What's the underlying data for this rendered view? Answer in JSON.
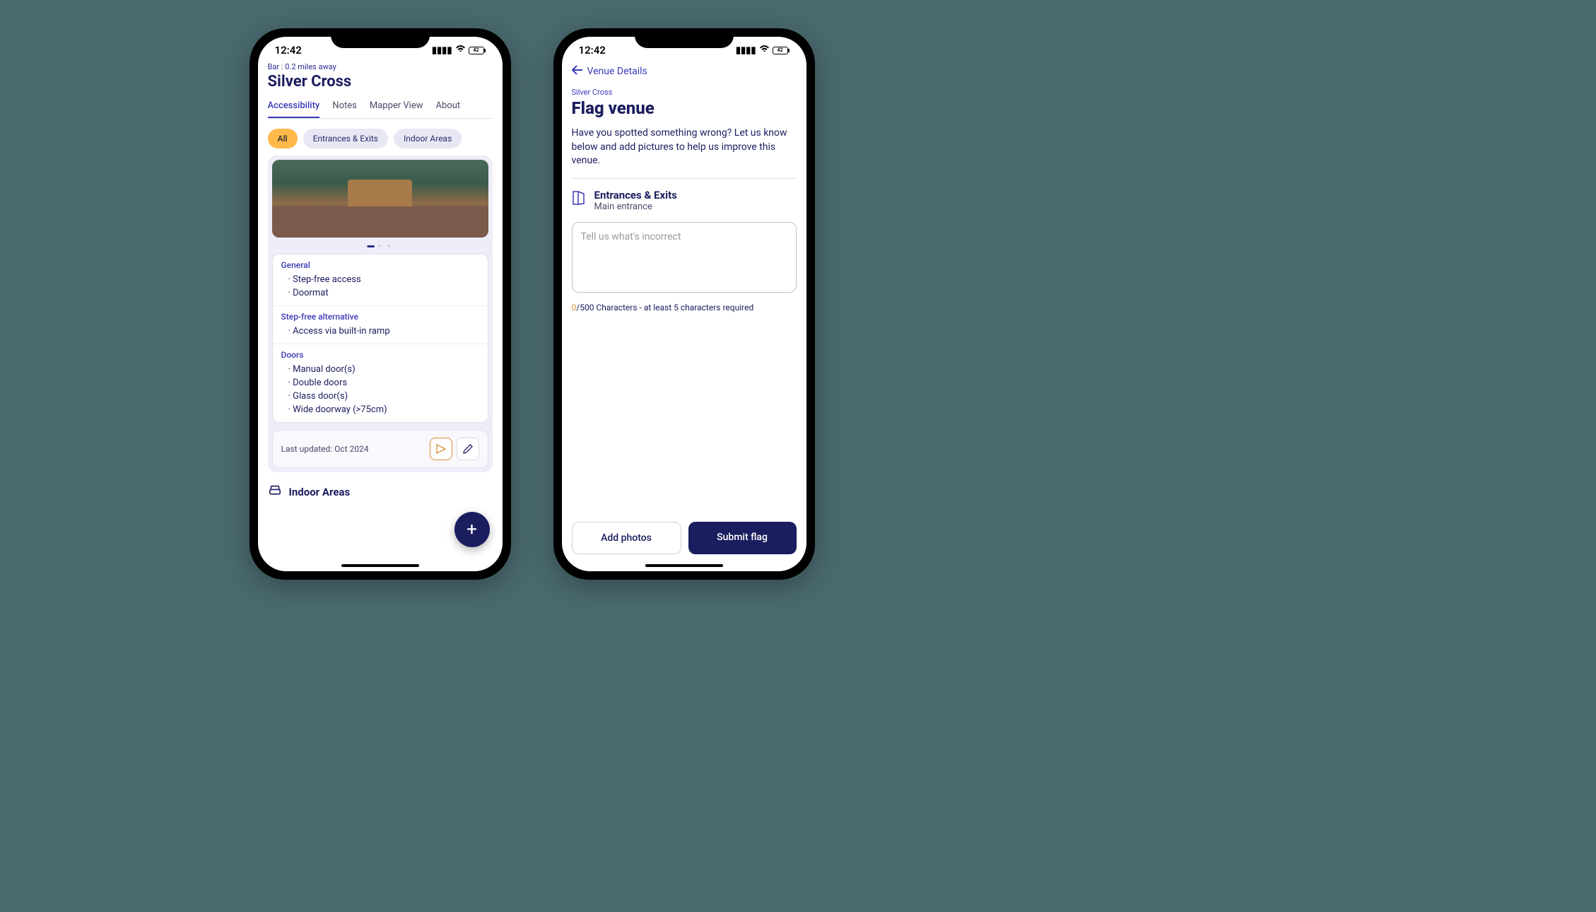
{
  "status": {
    "time": "12:42",
    "battery": "42"
  },
  "screen1": {
    "meta": {
      "category": "Bar",
      "distance": "0.2 miles away"
    },
    "title": "Silver Cross",
    "tabs": [
      "Accessibility",
      "Notes",
      "Mapper View",
      "About"
    ],
    "chips": [
      "All",
      "Entrances & Exits",
      "Indoor Areas"
    ],
    "sections": [
      {
        "heading": "General",
        "items": [
          "Step-free access",
          "Doormat"
        ]
      },
      {
        "heading": "Step-free alternative",
        "items": [
          "Access via built-in ramp"
        ]
      },
      {
        "heading": "Doors",
        "items": [
          "Manual door(s)",
          "Double doors",
          "Glass door(s)",
          "Wide doorway (>75cm)"
        ]
      }
    ],
    "updated": "Last updated: Oct 2024",
    "indoor_header": "Indoor Areas"
  },
  "screen2": {
    "back": "Venue Details",
    "venue": "Silver Cross",
    "title": "Flag venue",
    "desc": "Have you spotted something wrong? Let us know below and add pictures to help us improve this venue.",
    "section": {
      "title": "Entrances & Exits",
      "sub": "Main entrance"
    },
    "placeholder": "Tell us what's incorrect",
    "counter_zero": "0",
    "counter_rest": "/500 Characters - at least 5 characters required",
    "btn_secondary": "Add photos",
    "btn_primary": "Submit flag"
  }
}
